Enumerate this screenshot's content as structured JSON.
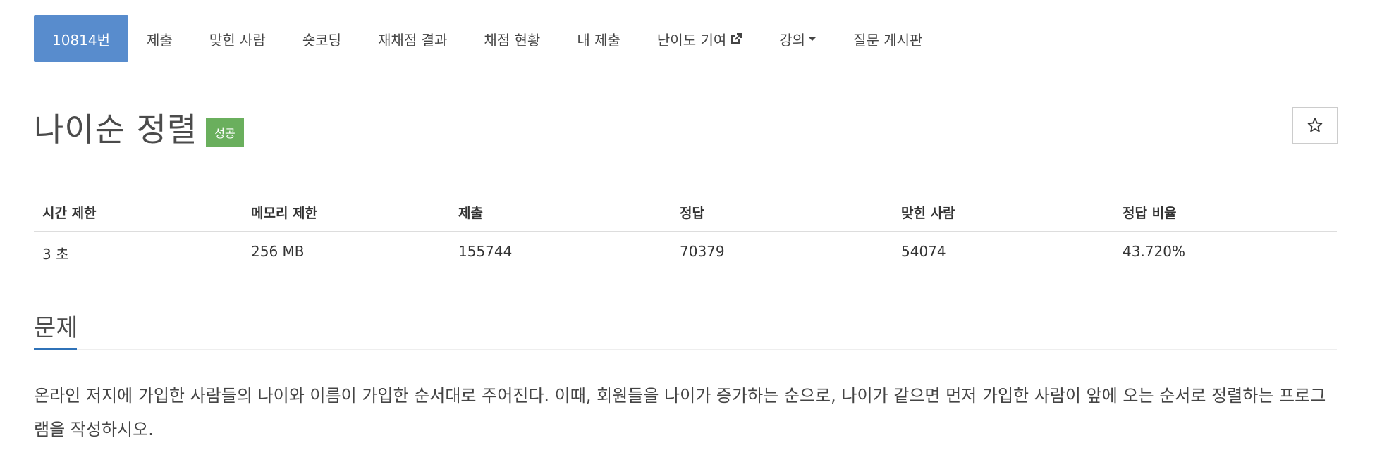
{
  "nav": {
    "tabs": [
      {
        "label": "10814번",
        "active": true
      },
      {
        "label": "제출"
      },
      {
        "label": "맞힌 사람"
      },
      {
        "label": "숏코딩"
      },
      {
        "label": "재채점 결과"
      },
      {
        "label": "채점 현황"
      },
      {
        "label": "내 제출"
      },
      {
        "label": "난이도 기여",
        "icon": "external-link-icon"
      },
      {
        "label": "강의",
        "icon": "caret-down-icon"
      },
      {
        "label": "질문 게시판"
      }
    ]
  },
  "problem": {
    "title": "나이순 정렬",
    "badge": "성공",
    "star": "☆"
  },
  "info_table": {
    "headers": [
      "시간 제한",
      "메모리 제한",
      "제출",
      "정답",
      "맞힌 사람",
      "정답 비율"
    ],
    "values": [
      "3 초",
      "256 MB",
      "155744",
      "70379",
      "54074",
      "43.720%"
    ]
  },
  "section": {
    "heading": "문제",
    "description": "온라인 저지에 가입한 사람들의 나이와 이름이 가입한 순서대로 주어진다. 이때, 회원들을 나이가 증가하는 순으로, 나이가 같으면 먼저 가입한 사람이 앞에 오는 순서로 정렬하는 프로그램을 작성하시오."
  },
  "colors": {
    "active_tab": "#588ccd",
    "badge": "#6aaf5d",
    "section_underline": "#2f72b8"
  }
}
